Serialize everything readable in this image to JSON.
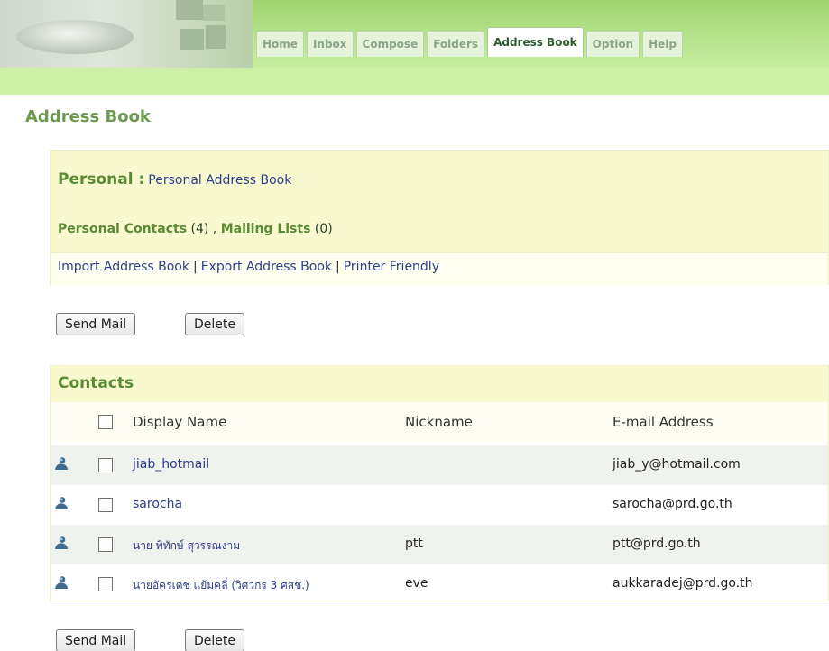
{
  "header": {
    "tabs": [
      {
        "label": "Home",
        "active": false
      },
      {
        "label": "Inbox",
        "active": false
      },
      {
        "label": "Compose",
        "active": false
      },
      {
        "label": "Folders",
        "active": false
      },
      {
        "label": "Address Book",
        "active": true
      },
      {
        "label": "Option",
        "active": false
      },
      {
        "label": "Help",
        "active": false
      }
    ]
  },
  "page": {
    "title": "Address Book"
  },
  "personal": {
    "heading": "Personal :",
    "subheading": "Personal Address Book",
    "contacts_label": "Personal Contacts",
    "contacts_count": "(4)",
    "lists_label": "Mailing Lists",
    "lists_count": "(0)",
    "links": [
      "Import Address Book",
      "Export Address Book",
      "Printer Friendly"
    ]
  },
  "buttons": {
    "send_mail": "Send Mail",
    "delete": "Delete"
  },
  "contacts": {
    "title": "Contacts",
    "columns": {
      "display_name": "Display Name",
      "nickname": "Nickname",
      "email": "E-mail Address"
    },
    "rows": [
      {
        "display_name": "jiab_hotmail",
        "nickname": "",
        "email": "jiab_y@hotmail.com"
      },
      {
        "display_name": "sarocha",
        "nickname": "",
        "email": "sarocha@prd.go.th"
      },
      {
        "display_name": "นาย พิทักษ์ สุวรรณงาม",
        "nickname": "ptt",
        "email": "ptt@prd.go.th"
      },
      {
        "display_name": "นายอัครเดช แย้มคลี่ (วิศวกร 3 ศสช.)",
        "nickname": "eve",
        "email": "aukkaradej@prd.go.th"
      }
    ]
  },
  "colors": {
    "accent_green": "#5a8a33",
    "link_blue": "#2d3d8a",
    "panel_yellow": "#f9f9cf"
  },
  "icons": {
    "contact": "person-icon"
  }
}
